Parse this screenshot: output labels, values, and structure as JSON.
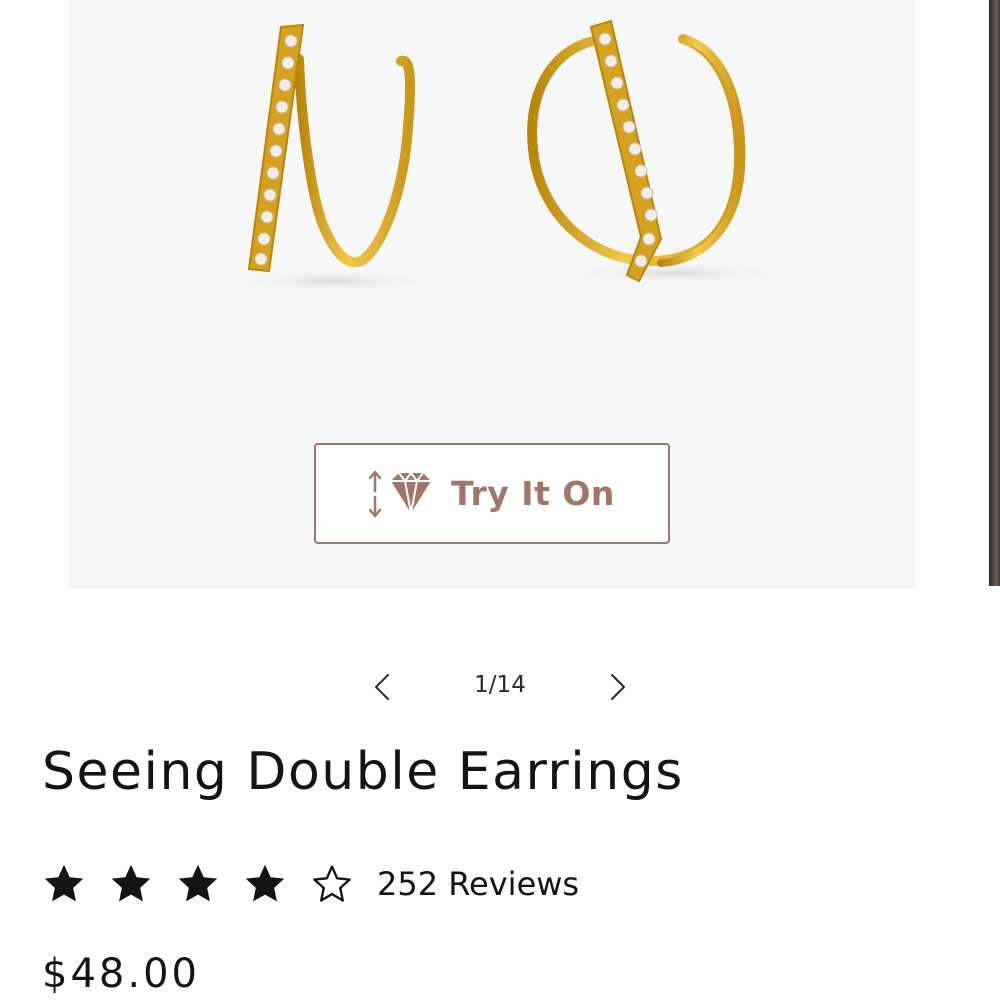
{
  "gallery": {
    "try_on_label": "Try It On",
    "try_on_icon": "try-on-diamond-icon",
    "pager": {
      "current": "1/14",
      "prev_icon": "chevron-left-icon",
      "next_icon": "chevron-right-icon"
    }
  },
  "product": {
    "title": "Seeing Double Earrings",
    "rating": {
      "value": 4,
      "max": 5,
      "reviews_label": "252 Reviews"
    },
    "price": "$48.00"
  },
  "colors": {
    "accent": "#a1766a",
    "gold": "#d9a521",
    "text": "#141414"
  }
}
